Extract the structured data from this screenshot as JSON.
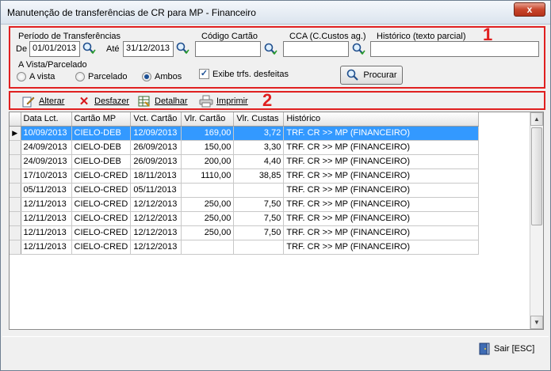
{
  "window": {
    "title": "Manutenção de transferências de CR para MP - Financeiro",
    "close_label": "x"
  },
  "annotations": {
    "box1": "1",
    "box2": "2"
  },
  "filters": {
    "periodo_label": "Período de Transferências",
    "de_label": "De",
    "de_value": "01/01/2013",
    "ate_label": "Até",
    "ate_value": "31/12/2013",
    "codigo_cartao_label": "Código Cartão",
    "codigo_cartao_value": "",
    "cca_label": "CCA (C.Custos ag.)",
    "cca_value": "",
    "historico_label": "Histórico (texto parcial)",
    "historico_value": "",
    "vista_parcelado_label": "A Vista/Parcelado",
    "radio_a_vista": "A vista",
    "radio_parcelado": "Parcelado",
    "radio_ambos": "Ambos",
    "selected_option": "Ambos",
    "exibe_desfeitas_label": "Exibe trfs. desfeitas",
    "exibe_desfeitas_checked": true,
    "procurar_label": "Procurar"
  },
  "toolbar": {
    "alterar": "Alterar",
    "desfazer": "Desfazer",
    "detalhar": "Detalhar",
    "imprimir": "Imprimir"
  },
  "grid": {
    "columns": [
      "Data Lct.",
      "Cartão MP",
      "Vct. Cartão",
      "Vlr. Cartão",
      "Vlr. Custas",
      "Histórico"
    ],
    "rows": [
      [
        "10/09/2013",
        "CIELO-DEB",
        "12/09/2013",
        "169,00",
        "3,72",
        "TRF. CR >> MP (FINANCEIRO)"
      ],
      [
        "24/09/2013",
        "CIELO-DEB",
        "26/09/2013",
        "150,00",
        "3,30",
        "TRF. CR >> MP (FINANCEIRO)"
      ],
      [
        "24/09/2013",
        "CIELO-DEB",
        "26/09/2013",
        "200,00",
        "4,40",
        "TRF. CR >> MP (FINANCEIRO)"
      ],
      [
        "17/10/2013",
        "CIELO-CRED",
        "18/11/2013",
        "1110,00",
        "38,85",
        "TRF. CR >> MP (FINANCEIRO)"
      ],
      [
        "05/11/2013",
        "CIELO-CRED",
        "05/11/2013",
        "",
        "",
        "TRF. CR >> MP (FINANCEIRO)"
      ],
      [
        "12/11/2013",
        "CIELO-CRED",
        "12/12/2013",
        "250,00",
        "7,50",
        "TRF. CR >> MP (FINANCEIRO)"
      ],
      [
        "12/11/2013",
        "CIELO-CRED",
        "12/12/2013",
        "250,00",
        "7,50",
        "TRF. CR >> MP (FINANCEIRO)"
      ],
      [
        "12/11/2013",
        "CIELO-CRED",
        "12/12/2013",
        "250,00",
        "7,50",
        "TRF. CR >> MP (FINANCEIRO)"
      ],
      [
        "12/11/2013",
        "CIELO-CRED",
        "12/12/2013",
        "",
        "",
        "TRF. CR >> MP (FINANCEIRO)"
      ]
    ],
    "selected_row": 0
  },
  "footer": {
    "sair_label": "Sair [ESC]"
  },
  "colors": {
    "highlight": "#e02020",
    "selection": "#3399ff"
  }
}
